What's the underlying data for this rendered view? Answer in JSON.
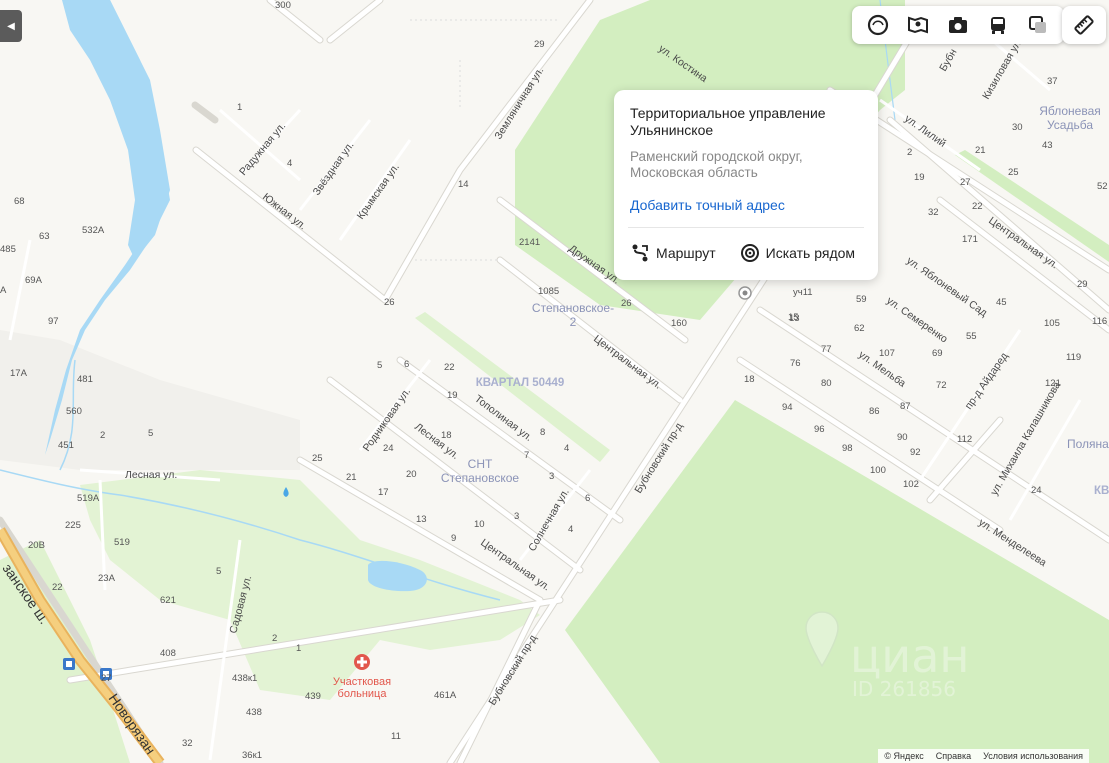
{
  "map": {
    "streets": {
      "raduzhnaya": "Радужная ул.",
      "zvezdnaya": "Звёздная ул.",
      "krymskaya": "Крымская ул.",
      "yuzhnaya": "Южная ул.",
      "zemlyanichnaya": "Земляничная ул.",
      "kostina": "ул. Костина",
      "druzhnaya": "Дружная ул.",
      "centralnaya_mid": "Центральная ул.",
      "rodnikovaya": "Родниковая ул.",
      "lesnaya_mid": "Лесная ул.",
      "topolinaya": "Тополиная ул.",
      "solnechnaya": "Солнечная ул.",
      "centralnaya_low": "Центральная ул.",
      "lesnaya_left": "Лесная ул.",
      "bubnovsky_mid": "Бубновский пр-д",
      "bubnovsky_low": "Бубновский пр-д",
      "sadovaya": "Садовая ул.",
      "novoryazanskoe_top": "занское ш.",
      "novoryazanskoe_bottom": "Новорязан",
      "kizilovaya": "Кизиловая ул.",
      "bubnovsky_top": "Бубн",
      "liliy": "ул. Лилий",
      "centralnaya_right": "Центральная ул.",
      "yablonevy_sad": "ул. Яблоневый Сад",
      "semerenko": "ул. Семеренко",
      "melba": "ул. Мельба",
      "aydared": "пр-д Айдаред",
      "kalashnikova": "ул. Михаила Калашникова",
      "mendeleeva": "ул. Менделеева"
    },
    "areas": {
      "stepanovskoe2_a": "Степановское-",
      "stepanovskoe2_b": "2",
      "kvartal": "КВАРТАЛ 50449",
      "snt_a": "СНТ",
      "snt_b": "Степановское",
      "yablonevaya_a": "Яблоневая",
      "yablonevaya_b": "Усадьба",
      "polyana": "Поляна",
      "kv": "КВ"
    },
    "hospital": {
      "line1": "Участковая",
      "line2": "больница"
    },
    "house_numbers": [
      "300",
      "29",
      "1",
      "4",
      "14",
      "68",
      "532А",
      "485",
      "63",
      "69А",
      "А",
      "97",
      "26",
      "2141",
      "1085",
      "26",
      "160",
      "17А",
      "481",
      "5",
      "6",
      "22",
      "19",
      "18",
      "8",
      "560",
      "451",
      "2",
      "5",
      "24",
      "7",
      "4",
      "3",
      "25",
      "21",
      "20",
      "17",
      "13",
      "10",
      "3",
      "9",
      "6",
      "4",
      "519А",
      "225",
      "519",
      "20В",
      "22",
      "23А",
      "5",
      "621",
      "2",
      "408",
      "1",
      "438к1",
      "439",
      "461А",
      "438",
      "27",
      "32",
      "36к1",
      "11",
      "37",
      "30",
      "43",
      "52",
      "2",
      "19",
      "27",
      "21",
      "25",
      "22",
      "32",
      "171",
      "29",
      "15",
      "уч11",
      "59",
      "45",
      "13",
      "62",
      "55",
      "105",
      "116",
      "107",
      "77",
      "69",
      "76",
      "80",
      "72",
      "119",
      "121",
      "94",
      "87",
      "96",
      "86",
      "90",
      "98",
      "100",
      "92",
      "112",
      "102",
      "24",
      "18"
    ],
    "watermark": {
      "brand": "циан",
      "id": "ID 261856"
    }
  },
  "toolbar": {
    "buttons": [
      "layers-icon",
      "panorama-icon",
      "photo-icon",
      "transport-icon",
      "traffic-icon"
    ],
    "ruler": "ruler-icon"
  },
  "popup": {
    "title": "Территориальное управление Ульянинское",
    "subtitle": "Раменский городской округ, Московская область",
    "add_address": "Добавить точный адрес",
    "route": "Маршрут",
    "search_nearby": "Искать рядом"
  },
  "footer": {
    "copyright": "© Яндекс",
    "help": "Справка",
    "terms": "Условия использования"
  }
}
